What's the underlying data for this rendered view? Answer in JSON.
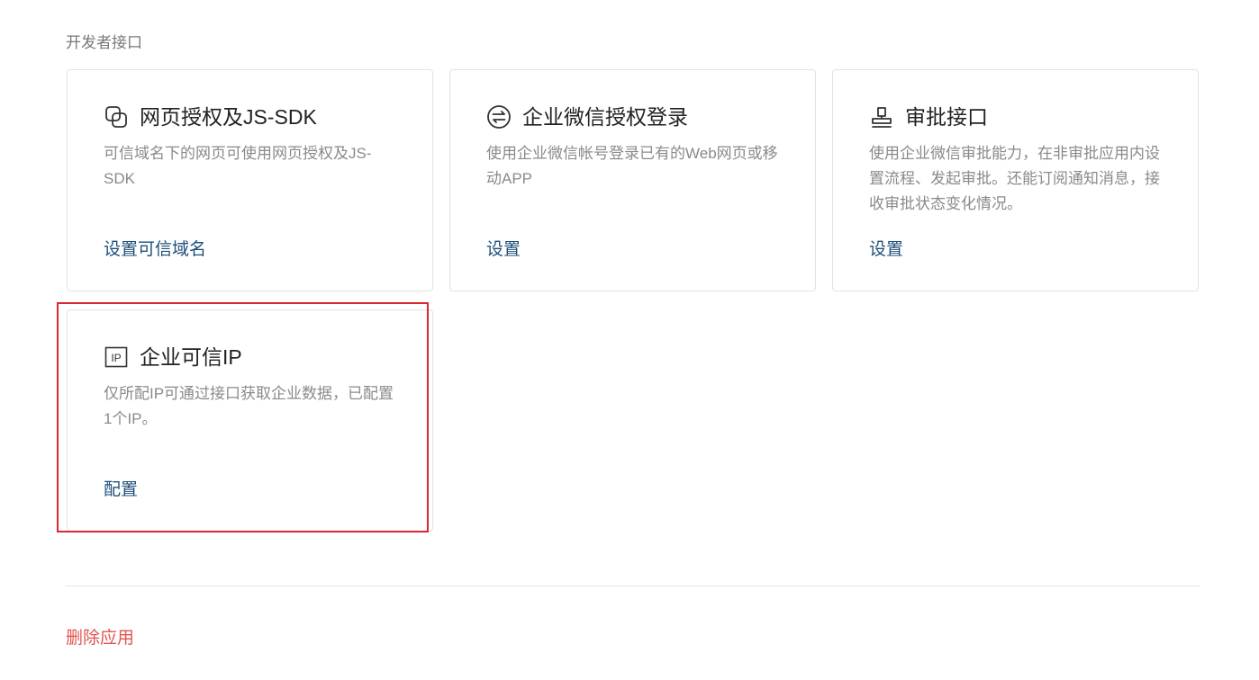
{
  "section": {
    "title": "开发者接口"
  },
  "cards": [
    {
      "title": "网页授权及JS-SDK",
      "description": "可信域名下的网页可使用网页授权及JS-SDK",
      "action": "设置可信域名",
      "icon": "copy-squares-icon"
    },
    {
      "title": "企业微信授权登录",
      "description": "使用企业微信帐号登录已有的Web网页或移动APP",
      "action": "设置",
      "icon": "exchange-arrows-icon"
    },
    {
      "title": "审批接口",
      "description": "使用企业微信审批能力，在非审批应用内设置流程、发起审批。还能订阅通知消息，接收审批状态变化情况。",
      "action": "设置",
      "icon": "stamp-icon"
    },
    {
      "title": "企业可信IP",
      "description": "仅所配IP可通过接口获取企业数据，已配置1个IP。",
      "action": "配置",
      "icon": "ip-box-icon",
      "icon_text": "IP",
      "highlighted": true
    }
  ],
  "footer": {
    "delete_label": "删除应用"
  },
  "colors": {
    "link": "#1e4f7a",
    "danger": "#e25450",
    "highlight": "#d9282f"
  }
}
